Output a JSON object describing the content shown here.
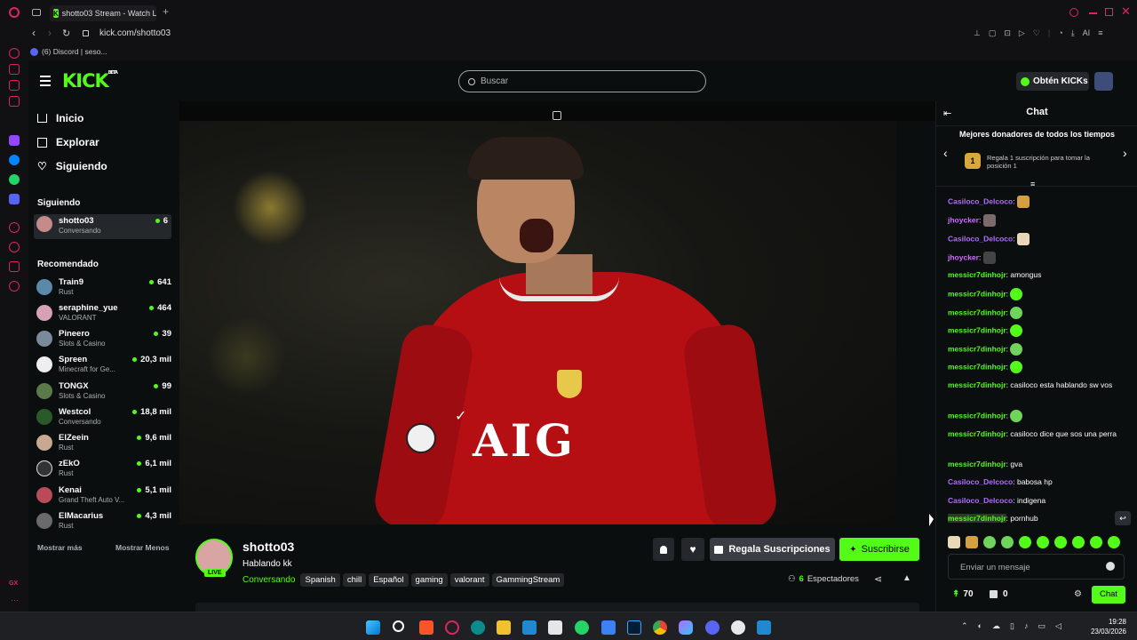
{
  "browser": {
    "tab_title": "shotto03 Stream - Watch L",
    "url": "kick.com/shotto03",
    "bookmark": "(6) Discord | seso..."
  },
  "header": {
    "logo": "KICK",
    "logo_beta": "BETA",
    "search_placeholder": "Buscar",
    "kicks_label": "Obtén KICKs"
  },
  "sidebar": {
    "nav": [
      {
        "label": "Inicio",
        "icon": "home-icon"
      },
      {
        "label": "Explorar",
        "icon": "explore-icon"
      },
      {
        "label": "Siguiendo",
        "icon": "heart-icon"
      }
    ],
    "following_title": "Siguiendo",
    "following": [
      {
        "name": "shotto03",
        "category": "Conversando",
        "viewers": "6"
      }
    ],
    "recommended_title": "Recomendado",
    "recommended": [
      {
        "name": "Train9",
        "category": "Rust",
        "viewers": "641"
      },
      {
        "name": "seraphine_yue",
        "category": "VALORANT",
        "viewers": "464"
      },
      {
        "name": "Pineero",
        "category": "Slots & Casino",
        "viewers": "39"
      },
      {
        "name": "Spreen",
        "category": "Minecraft for Ge...",
        "viewers": "20,3 mil"
      },
      {
        "name": "TONGX",
        "category": "Slots & Casino",
        "viewers": "99"
      },
      {
        "name": "Westcol",
        "category": "Conversando",
        "viewers": "18,8 mil"
      },
      {
        "name": "ElZeein",
        "category": "Rust",
        "viewers": "9,6 mil"
      },
      {
        "name": "zEkO",
        "category": "Rust",
        "viewers": "6,1 mil"
      },
      {
        "name": "Kenai",
        "category": "Grand Theft Auto V...",
        "viewers": "5,1 mil"
      },
      {
        "name": "ElMacarius",
        "category": "Rust",
        "viewers": "4,3 mil"
      }
    ],
    "show_more": "Mostrar más",
    "show_less": "Mostrar Menos"
  },
  "stream": {
    "channel": "shotto03",
    "title": "Hablando kk",
    "category": "Conversando",
    "live_badge": "LIVE",
    "tags": [
      "Spanish",
      "chill",
      "Español",
      "gaming",
      "valorant",
      "GammingStream"
    ],
    "gift_label": "Regala Suscripciones",
    "subscribe_label": "Suscribirse",
    "viewers": "6",
    "viewers_label": "Espectadores",
    "jersey_text": "AIG"
  },
  "chat": {
    "title": "Chat",
    "donors_title": "Mejores donadores de todos los tiempos",
    "donors_rank": "1",
    "donors_text": "Regala 1 suscripción para tomar la posición 1",
    "messages": [
      {
        "user": "Casiloco_Delcoco",
        "text": "",
        "emote": "img",
        "color": "p"
      },
      {
        "user": "jhoycker",
        "text": "",
        "emote": "img",
        "color": "pink"
      },
      {
        "user": "Casiloco_Delcoco",
        "text": "",
        "emote": "img",
        "color": "p"
      },
      {
        "user": "jhoycker",
        "text": "",
        "emote": "img",
        "color": "pink"
      },
      {
        "user": "messicr7dinhojr",
        "text": "amongus",
        "emote": "",
        "color": "g"
      },
      {
        "user": "messicr7dinhojr",
        "text": "",
        "emote": "green",
        "color": "g"
      },
      {
        "user": "messicr7dinhojr",
        "text": "",
        "emote": "green",
        "color": "g"
      },
      {
        "user": "messicr7dinhojr",
        "text": "",
        "emote": "green",
        "color": "g"
      },
      {
        "user": "messicr7dinhojr",
        "text": "",
        "emote": "green",
        "color": "g"
      },
      {
        "user": "messicr7dinhojr",
        "text": "",
        "emote": "green",
        "color": "g"
      },
      {
        "user": "messicr7dinhojr",
        "text": "casiloco esta hablando sw vos",
        "emote": "",
        "color": "g"
      },
      {
        "user": "messicr7dinhojr",
        "text": "",
        "emote": "green",
        "color": "g"
      },
      {
        "user": "messicr7dinhojr",
        "text": "casiloco dice que sos una perra",
        "emote": "",
        "color": "g"
      },
      {
        "user": "messicr7dinhojr",
        "text": "gva",
        "emote": "",
        "color": "g"
      },
      {
        "user": "Casiloco_Delcoco",
        "text": "babosa hp",
        "emote": "",
        "color": "p"
      },
      {
        "user": "Casiloco_Delcoco",
        "text": "indigena",
        "emote": "",
        "color": "p"
      },
      {
        "user": "messicr7dinhojr",
        "text": "pornhub",
        "emote": "",
        "color": "g"
      }
    ],
    "input_placeholder": "Enviar un mensaje",
    "points": "70",
    "gifts": "0",
    "send_label": "Chat"
  },
  "taskbar": {
    "time": "19:28",
    "date": "23/03/2026"
  }
}
